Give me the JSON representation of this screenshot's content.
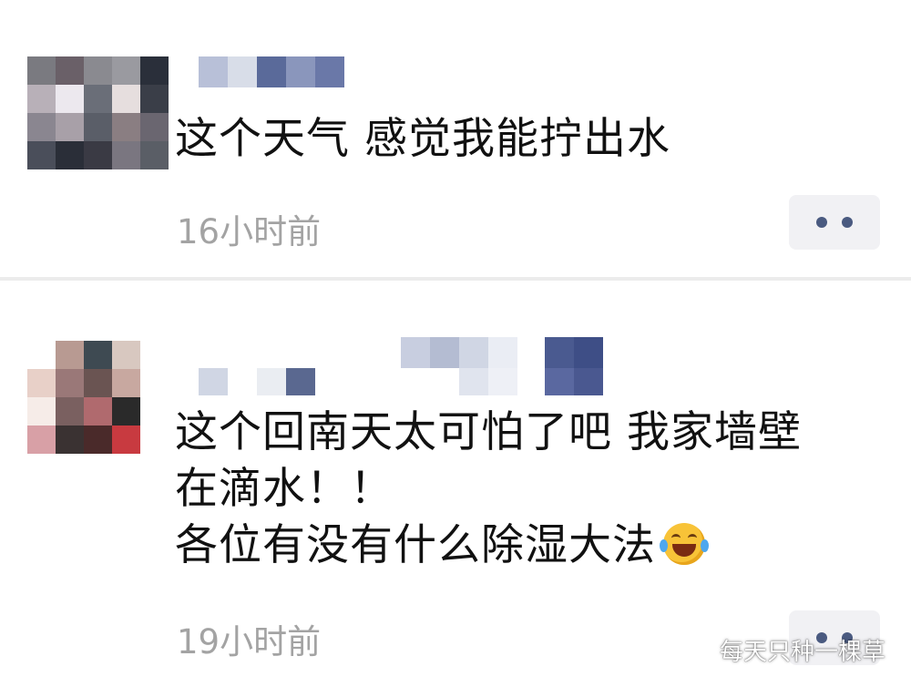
{
  "posts": [
    {
      "text_lines": [
        "这个天气 感觉我能拧出水"
      ],
      "time": "16小时前",
      "icons": {
        "more": "more-dots-icon"
      }
    },
    {
      "text_lines": [
        "这个回南天太可怕了吧 我家墙壁",
        "在滴水！！",
        "各位有没有什么除湿大法"
      ],
      "time": "19小时前",
      "icons": {
        "emoji": "laughing-crying-emoji-icon",
        "more": "more-dots-icon"
      }
    }
  ],
  "watermark": {
    "text": "每天只种一棵草",
    "icon": "wechat-channel-icon"
  },
  "colors": {
    "text": "#111111",
    "timestamp": "#a3a3a3",
    "more_button_bg": "#f1f1f4",
    "more_dots": "#4a5a80",
    "divider": "#ececec"
  }
}
